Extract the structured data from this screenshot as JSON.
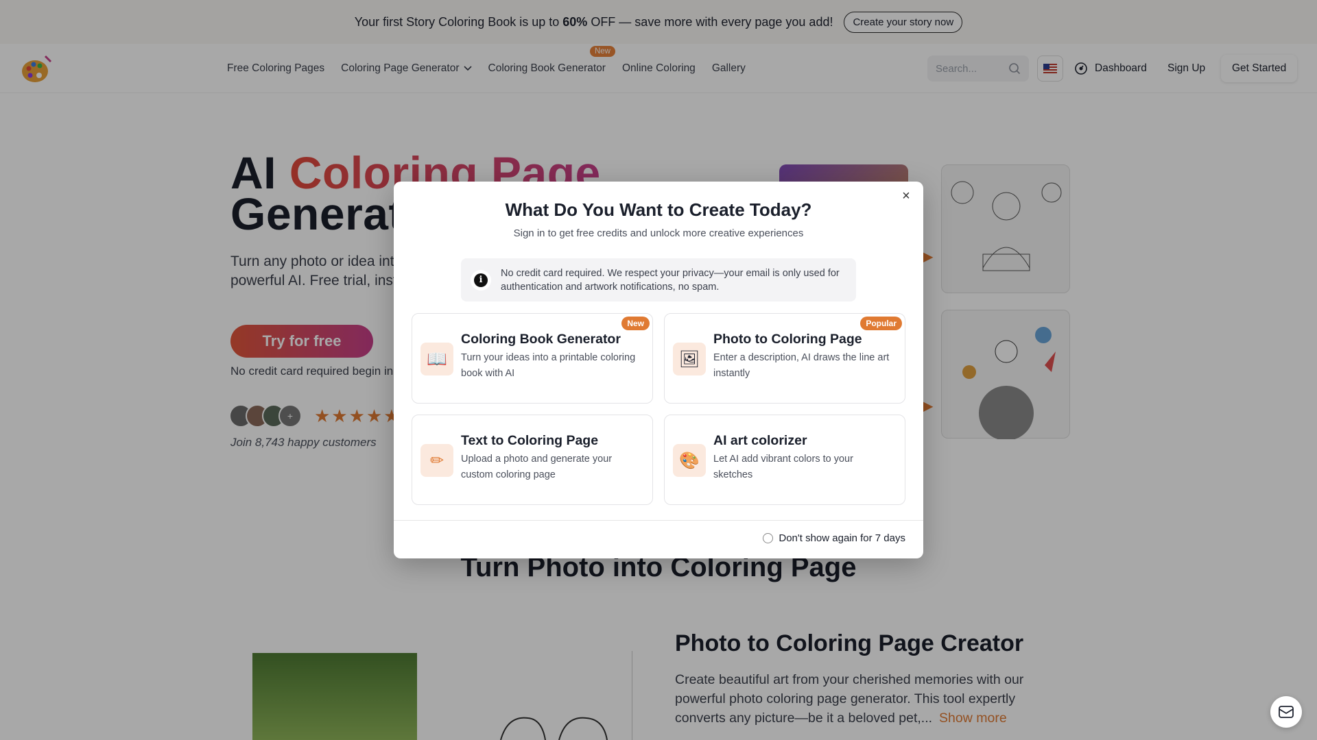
{
  "promo": {
    "text_before": "Your first Story Coloring Book is up to ",
    "discount": "60%",
    "text_after": " OFF — save more with every page you add!",
    "cta": "Create your story now"
  },
  "nav": {
    "links": [
      {
        "label": "Free Coloring Pages"
      },
      {
        "label": "Coloring Page Generator"
      },
      {
        "label": "Coloring Book Generator",
        "tag": "New"
      },
      {
        "label": "Online Coloring"
      },
      {
        "label": "Gallery"
      }
    ],
    "search_placeholder": "Search...",
    "dashboard": "Dashboard",
    "sign_up": "Sign Up",
    "get_started": "Get Started"
  },
  "hero": {
    "title_plain": "AI ",
    "title_gradient": "Coloring Page",
    "title_line2": "Generator",
    "description": "Turn any photo or idea into a coloring page with our powerful AI. Free trial, instant download.",
    "try_button": "Try for free",
    "no_cc": "No credit card required begin in seconds",
    "stars": "★★★★★",
    "avatar_more": "+",
    "join": "Join 8,743 happy customers"
  },
  "section": {
    "title": "Turn Photo into Coloring Page",
    "creator_title": "Photo to Coloring Page Creator",
    "creator_desc": "Create beautiful art from your cherished memories with our powerful photo coloring page generator. This tool expertly converts any picture—be it a beloved pet,...",
    "show_more": "Show more"
  },
  "modal": {
    "close": "×",
    "title": "What Do You Want to Create Today?",
    "subtitle": "Sign in to get free credits and unlock more creative experiences",
    "notice": "No credit card required. We respect your privacy—your email is only used for authentication and artwork notifications, no spam.",
    "info_glyph": "i",
    "cards": [
      {
        "title": "Coloring Book Generator",
        "desc": "Turn your ideas into a printable coloring book with AI",
        "badge": "New",
        "icon": "book-icon",
        "glyph": "📖"
      },
      {
        "title": "Photo to Coloring Page",
        "desc": "Enter a description, AI draws the line art instantly",
        "badge": "Popular",
        "icon": "picture-icon",
        "glyph": "🖼"
      },
      {
        "title": "Text to Coloring Page",
        "desc": "Upload a photo and generate your custom coloring page",
        "badge": "",
        "icon": "pencil-icon",
        "glyph": "✏"
      },
      {
        "title": "AI art colorizer",
        "desc": "Let AI add vibrant colors to your sketches",
        "badge": "",
        "icon": "palette-icon",
        "glyph": "🎨"
      }
    ],
    "dont_show": "Don't show again for 7 days"
  },
  "colors": {
    "accent": "#e07a32",
    "gradient_start": "#e24a3b",
    "gradient_end": "#c7408b",
    "overlay": "rgba(0,0,0,0.34)"
  }
}
